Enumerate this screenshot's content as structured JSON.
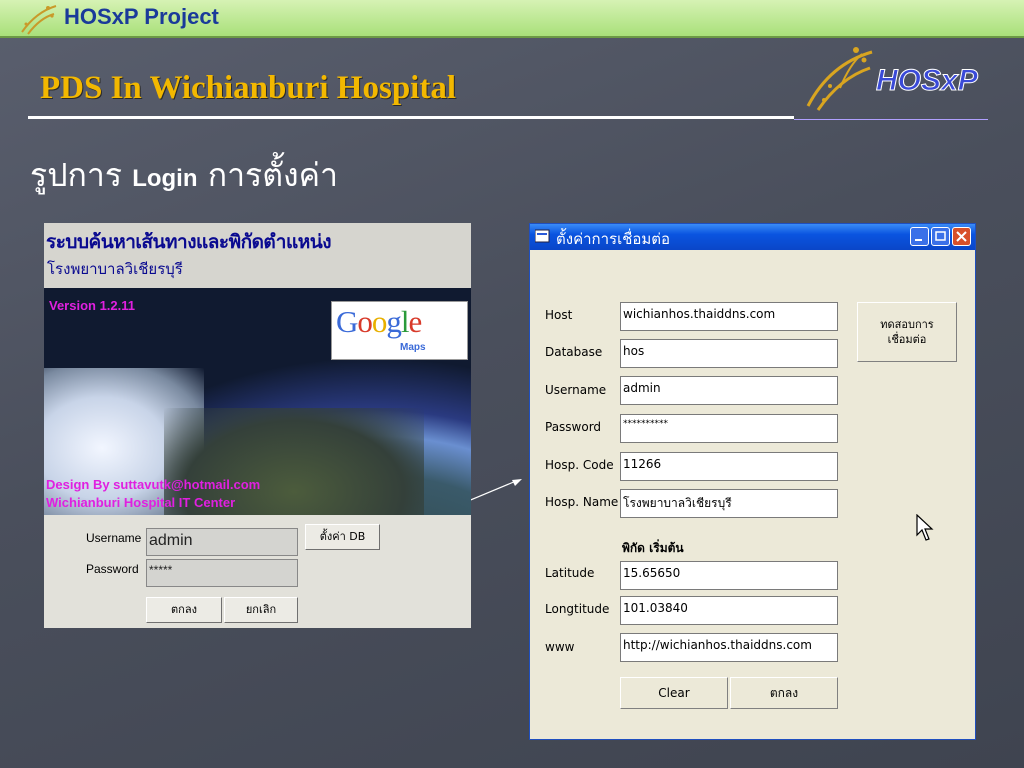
{
  "banner": {
    "text": "HOSxP Project"
  },
  "slide": {
    "title": "PDS In Wichianburi Hospital",
    "subtitle_pre": "รูปการ ",
    "subtitle_latin": "Login",
    "subtitle_post": " การตั้งค่า"
  },
  "brand_logo": {
    "text": "HOSxP"
  },
  "splash": {
    "title": "ระบบค้นหาเส้นทางและพิกัดตำแหน่ง",
    "subtitle": "โรงพยาบาลวิเชียรบุรี",
    "version": "Version  1.2.11",
    "maps_logo": {
      "google": "Google",
      "maps": "Maps"
    },
    "design_line1": "Design By suttavutk@hotmail.com",
    "design_line2": "Wichianburi Hospital IT Center",
    "username_label": "Username",
    "password_label": "Password",
    "username_value": "admin",
    "password_value": "*****",
    "settings_button": "ตั้งค่า DB",
    "ok_button": "ตกลง",
    "cancel_button": "ยกเลิก"
  },
  "dialog": {
    "title": "ตั้งค่าการเชื่อมต่อ",
    "fields": {
      "host": {
        "label": "Host",
        "value": "wichianhos.thaiddns.com"
      },
      "database": {
        "label": "Database",
        "value": "hos"
      },
      "username": {
        "label": "Username",
        "value": "admin"
      },
      "password": {
        "label": "Password",
        "value": "**********"
      },
      "hosp_code": {
        "label": "Hosp. Code",
        "value": "11266"
      },
      "hosp_name": {
        "label": "Hosp. Name",
        "value": "โรงพยาบาลวิเชียรบุรี"
      },
      "latitude": {
        "label": "Latitude",
        "value": "15.65650"
      },
      "longitude": {
        "label": "Longtitude",
        "value": "101.03840"
      },
      "www": {
        "label": "www",
        "value": "http://wichianhos.thaiddns.com"
      }
    },
    "coords_section": "พิกัด เริ่มต้น",
    "test_button_line1": "ทดสอบการ",
    "test_button_line2": "เชื่อมต่อ",
    "clear_button": "Clear",
    "ok_button": "ตกลง"
  },
  "colors": {
    "title": "#f3b800",
    "titlebar": "#0a54e0",
    "banner": "#a9e07a"
  }
}
